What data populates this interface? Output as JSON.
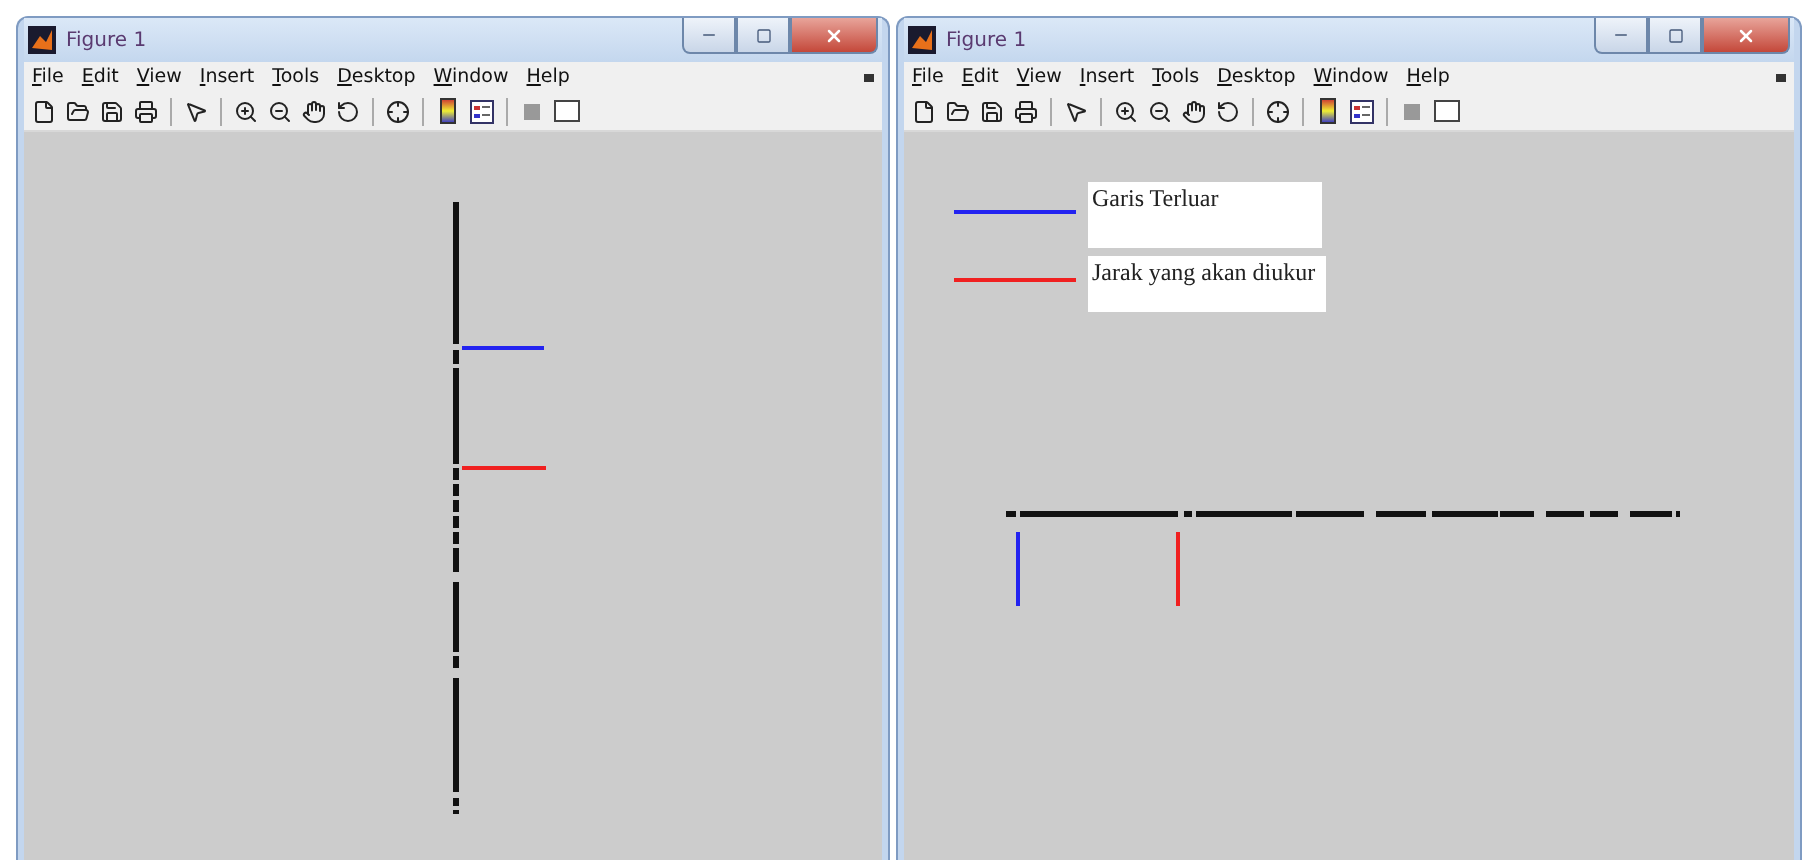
{
  "windows": [
    {
      "title": "Figure 1",
      "menus": [
        "File",
        "Edit",
        "View",
        "Insert",
        "Tools",
        "Desktop",
        "Window",
        "Help"
      ],
      "plot": {
        "kind": "vertical"
      }
    },
    {
      "title": "Figure 1",
      "menus": [
        "File",
        "Edit",
        "View",
        "Insert",
        "Tools",
        "Desktop",
        "Window",
        "Help"
      ],
      "plot": {
        "kind": "horizontal",
        "legend": [
          {
            "label": "Garis Terluar",
            "color": "#2323f0"
          },
          {
            "label": "Jarak yang akan diukur",
            "color": "#f02020"
          }
        ]
      }
    }
  ]
}
